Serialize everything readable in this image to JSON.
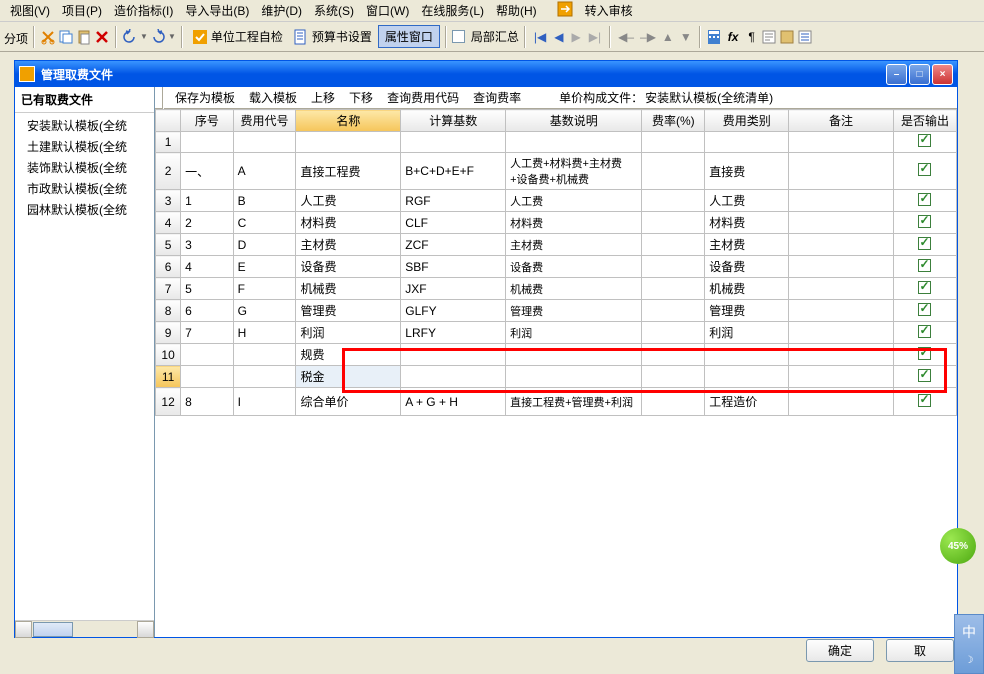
{
  "menus": [
    "视图(V)",
    "项目(P)",
    "造价指标(I)",
    "导入导出(B)",
    "维护(D)",
    "系统(S)",
    "窗口(W)",
    "在线服务(L)",
    "帮助(H)"
  ],
  "menu_last": "转入审核",
  "toolbar": {
    "btn_self": "单位工程自检",
    "btn_budget": "预算书设置",
    "btn_prop": "属性窗口",
    "chk_local": "局部汇总"
  },
  "left_text": "分项",
  "dialog": {
    "title": "管理取费文件",
    "min": "–",
    "max": "□",
    "close": "×"
  },
  "panel_header": "已有取费文件",
  "tree_items": [
    "安装默认模板(全统",
    "土建默认模板(全统",
    "装饰默认模板(全统",
    "市政默认模板(全统",
    "园林默认模板(全统"
  ],
  "sub_toolbar": {
    "save_tpl": "保存为模板",
    "load_tpl": "载入模板",
    "move_up": "上移",
    "move_down": "下移",
    "query_code": "查询费用代码",
    "query_rate": "查询费率",
    "label": "单价构成文件：",
    "value": "安装默认模板(全统清单)"
  },
  "headers": [
    "序号",
    "费用代号",
    "名称",
    "计算基数",
    "基数说明",
    "费率(%)",
    "费用类别",
    "备注",
    "是否输出"
  ],
  "rows": [
    {
      "n": "1",
      "seq": "",
      "code": "",
      "name": "",
      "base": "",
      "desc": "",
      "rate": "",
      "type": "",
      "note": "",
      "out": true
    },
    {
      "n": "2",
      "seq": "一、",
      "code": "A",
      "name": "直接工程费",
      "base": "B+C+D+E+F",
      "desc": "人工费+材料费+主材费+设备费+机械费",
      "rate": "",
      "type": "直接费",
      "note": "",
      "out": true,
      "multiline": true
    },
    {
      "n": "3",
      "seq": "1",
      "code": "B",
      "name": "人工费",
      "base": "RGF",
      "desc": "人工费",
      "rate": "",
      "type": "人工费",
      "note": "",
      "out": true
    },
    {
      "n": "4",
      "seq": "2",
      "code": "C",
      "name": "材料费",
      "base": "CLF",
      "desc": "材料费",
      "rate": "",
      "type": "材料费",
      "note": "",
      "out": true
    },
    {
      "n": "5",
      "seq": "3",
      "code": "D",
      "name": "主材费",
      "base": "ZCF",
      "desc": "主材费",
      "rate": "",
      "type": "主材费",
      "note": "",
      "out": true
    },
    {
      "n": "6",
      "seq": "4",
      "code": "E",
      "name": "设备费",
      "base": "SBF",
      "desc": "设备费",
      "rate": "",
      "type": "设备费",
      "note": "",
      "out": true
    },
    {
      "n": "7",
      "seq": "5",
      "code": "F",
      "name": "机械费",
      "base": "JXF",
      "desc": "机械费",
      "rate": "",
      "type": "机械费",
      "note": "",
      "out": true
    },
    {
      "n": "8",
      "seq": "6",
      "code": "G",
      "name": "管理费",
      "base": "GLFY",
      "desc": "管理费",
      "rate": "",
      "type": "管理费",
      "note": "",
      "out": true
    },
    {
      "n": "9",
      "seq": "7",
      "code": "H",
      "name": "利润",
      "base": "LRFY",
      "desc": "利润",
      "rate": "",
      "type": "利润",
      "note": "",
      "out": true
    },
    {
      "n": "10",
      "seq": "",
      "code": "",
      "name": "规费",
      "base": "",
      "desc": "",
      "rate": "",
      "type": "",
      "note": "",
      "out": true
    },
    {
      "n": "11",
      "seq": "",
      "code": "",
      "name": "税金",
      "base": "",
      "desc": "",
      "rate": "",
      "type": "",
      "note": "",
      "out": true,
      "selected": true
    },
    {
      "n": "12",
      "seq": "8",
      "code": "I",
      "name": "综合单价",
      "base": "A + G + H",
      "desc": "直接工程费+管理费+利润",
      "rate": "",
      "type": "工程造价",
      "note": "",
      "out": true,
      "multiline": true
    }
  ],
  "footer": {
    "ok": "确定",
    "cancel": "取"
  },
  "progress": "45%",
  "side_widget": "中"
}
